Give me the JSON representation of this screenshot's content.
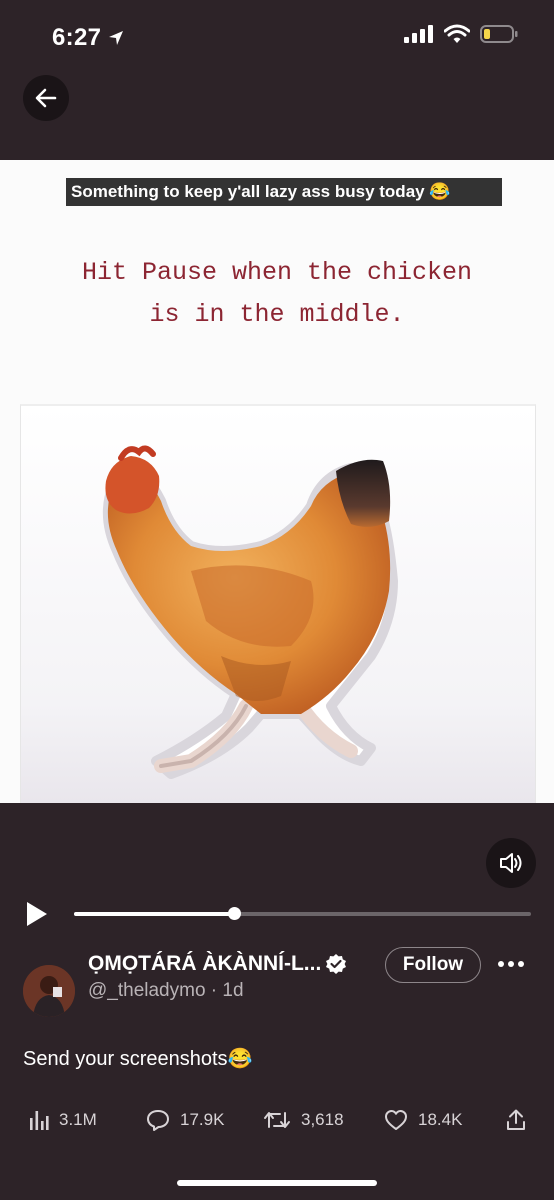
{
  "status_bar": {
    "time": "6:27",
    "icons": [
      "location-arrow-icon",
      "cellular-signal-icon",
      "wifi-icon",
      "battery-low-icon"
    ],
    "battery_color": "#f5d64a"
  },
  "video": {
    "overlay_caption": "Something to keep y'all lazy ass busy today 😂",
    "instruction_lines": [
      "Hit Pause when the chicken",
      "is in the middle."
    ],
    "instruction_color": "#8c2532",
    "progress": 0.35
  },
  "tweet": {
    "display_name": "ỌMỌTÁRÁ ÀKÀNNÍ-L...",
    "handle": "@_theladymo",
    "age": " · 1d",
    "follow_label": "Follow",
    "text": "Send your screenshots😂",
    "stats": {
      "views": "3.1M",
      "replies": "17.9K",
      "retweets": "3,618",
      "likes": "18.4K"
    }
  },
  "icons": {
    "back": "back-arrow-icon",
    "mute": "speaker-muted-icon",
    "play": "play-icon",
    "verified": "verified-badge-icon",
    "more": "more-dots-icon",
    "views": "views-bar-chart-icon",
    "reply": "reply-bubble-icon",
    "retweet": "retweet-icon",
    "like": "heart-icon",
    "share": "share-icon"
  }
}
